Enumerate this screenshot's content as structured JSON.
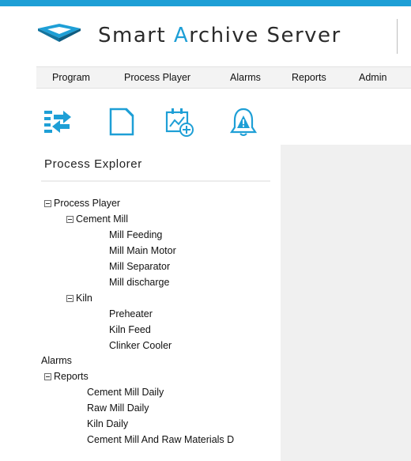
{
  "app": {
    "title_pre": "Smart ",
    "title_hl": "A",
    "title_post": "rchive Server",
    "accent": "#1e9fd6"
  },
  "menu": {
    "items": [
      "Program",
      "Process Player",
      "Alarms",
      "Reports",
      "Admin"
    ]
  },
  "toolbar": {
    "icons": [
      "process-list-icon",
      "new-document-icon",
      "add-chart-icon",
      "alarm-bell-icon"
    ]
  },
  "explorer": {
    "title": "Process Explorer",
    "tree": [
      {
        "label": "Process Player",
        "expanded": true
      },
      {
        "label": "Cement Mill",
        "expanded": true
      },
      {
        "label": "Mill Feeding"
      },
      {
        "label": "Mill Main Motor"
      },
      {
        "label": "Mill Separator"
      },
      {
        "label": "Mill discharge"
      },
      {
        "label": "Kiln",
        "expanded": true
      },
      {
        "label": "Preheater"
      },
      {
        "label": "Kiln Feed"
      },
      {
        "label": "Clinker Cooler"
      },
      {
        "label": "Alarms"
      },
      {
        "label": "Reports",
        "expanded": true
      },
      {
        "label": "Cement Mill Daily"
      },
      {
        "label": "Raw Mill Daily"
      },
      {
        "label": "Kiln Daily"
      },
      {
        "label": "Cement Mill And Raw Materials D"
      }
    ]
  }
}
